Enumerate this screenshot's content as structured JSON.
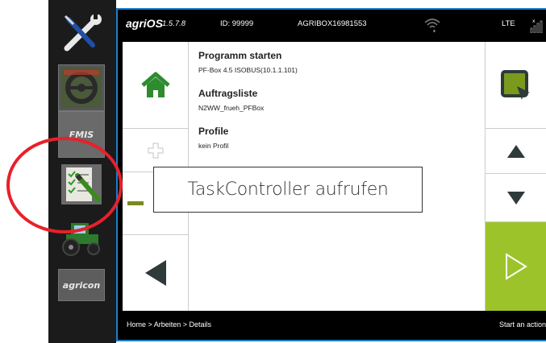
{
  "sidebar": {
    "items": [
      {
        "name": "settings-tools",
        "label": ""
      },
      {
        "name": "steering-wheel",
        "label": ""
      },
      {
        "name": "fmis",
        "label": "FMIS"
      },
      {
        "name": "task-controller",
        "label": ""
      },
      {
        "name": "tractor",
        "label": ""
      },
      {
        "name": "agricon",
        "label": "agricon"
      }
    ]
  },
  "status_bar": {
    "brand": "agriOS",
    "version": "1.5.7.8",
    "device_id": "ID: 99999",
    "box_id": "AGRIBOX16981553",
    "network": "LTE"
  },
  "details": {
    "start_program_label": "Programm starten",
    "start_program_value": "PF-Box 4.5 ISOBUS(10.1.1.101)",
    "job_list_label": "Auftragsliste",
    "job_list_value": "N2WW_frueh_PFBox",
    "profile_label": "Profile",
    "profile_value": "kein Profil"
  },
  "footer": {
    "breadcrumb": "Home > Arbeiten > Details",
    "hint": "Start an action"
  },
  "tooltip": {
    "text": "TaskController aufrufen"
  },
  "colors": {
    "accent_blue": "#1c7fc9",
    "start_green": "#9cc42a",
    "home_green": "#2e8b2e",
    "highlight_red": "#e8202a"
  }
}
